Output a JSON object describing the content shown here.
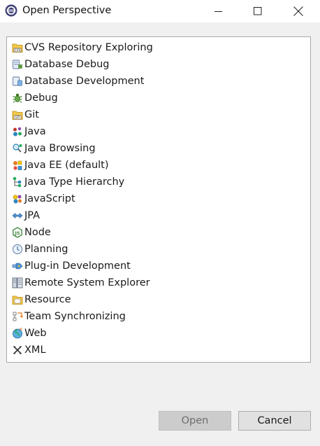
{
  "window": {
    "title": "Open Perspective",
    "app_icon": "eclipse-icon",
    "controls": [
      "minimize-icon",
      "maximize-icon",
      "close-icon"
    ]
  },
  "perspectives": [
    {
      "label": "CVS Repository Exploring",
      "icon": "cvs-repository-icon"
    },
    {
      "label": "Database Debug",
      "icon": "database-debug-icon"
    },
    {
      "label": "Database Development",
      "icon": "database-development-icon"
    },
    {
      "label": "Debug",
      "icon": "bug-icon"
    },
    {
      "label": "Git",
      "icon": "git-icon"
    },
    {
      "label": "Java",
      "icon": "java-icon"
    },
    {
      "label": "Java Browsing",
      "icon": "java-browsing-icon"
    },
    {
      "label": "Java EE (default)",
      "icon": "java-ee-icon"
    },
    {
      "label": "Java Type Hierarchy",
      "icon": "type-hierarchy-icon"
    },
    {
      "label": "JavaScript",
      "icon": "javascript-icon"
    },
    {
      "label": "JPA",
      "icon": "jpa-icon"
    },
    {
      "label": "Node",
      "icon": "nodejs-icon"
    },
    {
      "label": "Planning",
      "icon": "clock-icon"
    },
    {
      "label": "Plug-in Development",
      "icon": "plugin-icon"
    },
    {
      "label": "Remote System Explorer",
      "icon": "remote-system-icon"
    },
    {
      "label": "Resource",
      "icon": "folder-icon"
    },
    {
      "label": "Team Synchronizing",
      "icon": "team-sync-icon"
    },
    {
      "label": "Web",
      "icon": "globe-icon"
    },
    {
      "label": "XML",
      "icon": "xml-icon"
    }
  ],
  "buttons": {
    "open_label": "Open",
    "open_enabled": false,
    "cancel_label": "Cancel"
  }
}
